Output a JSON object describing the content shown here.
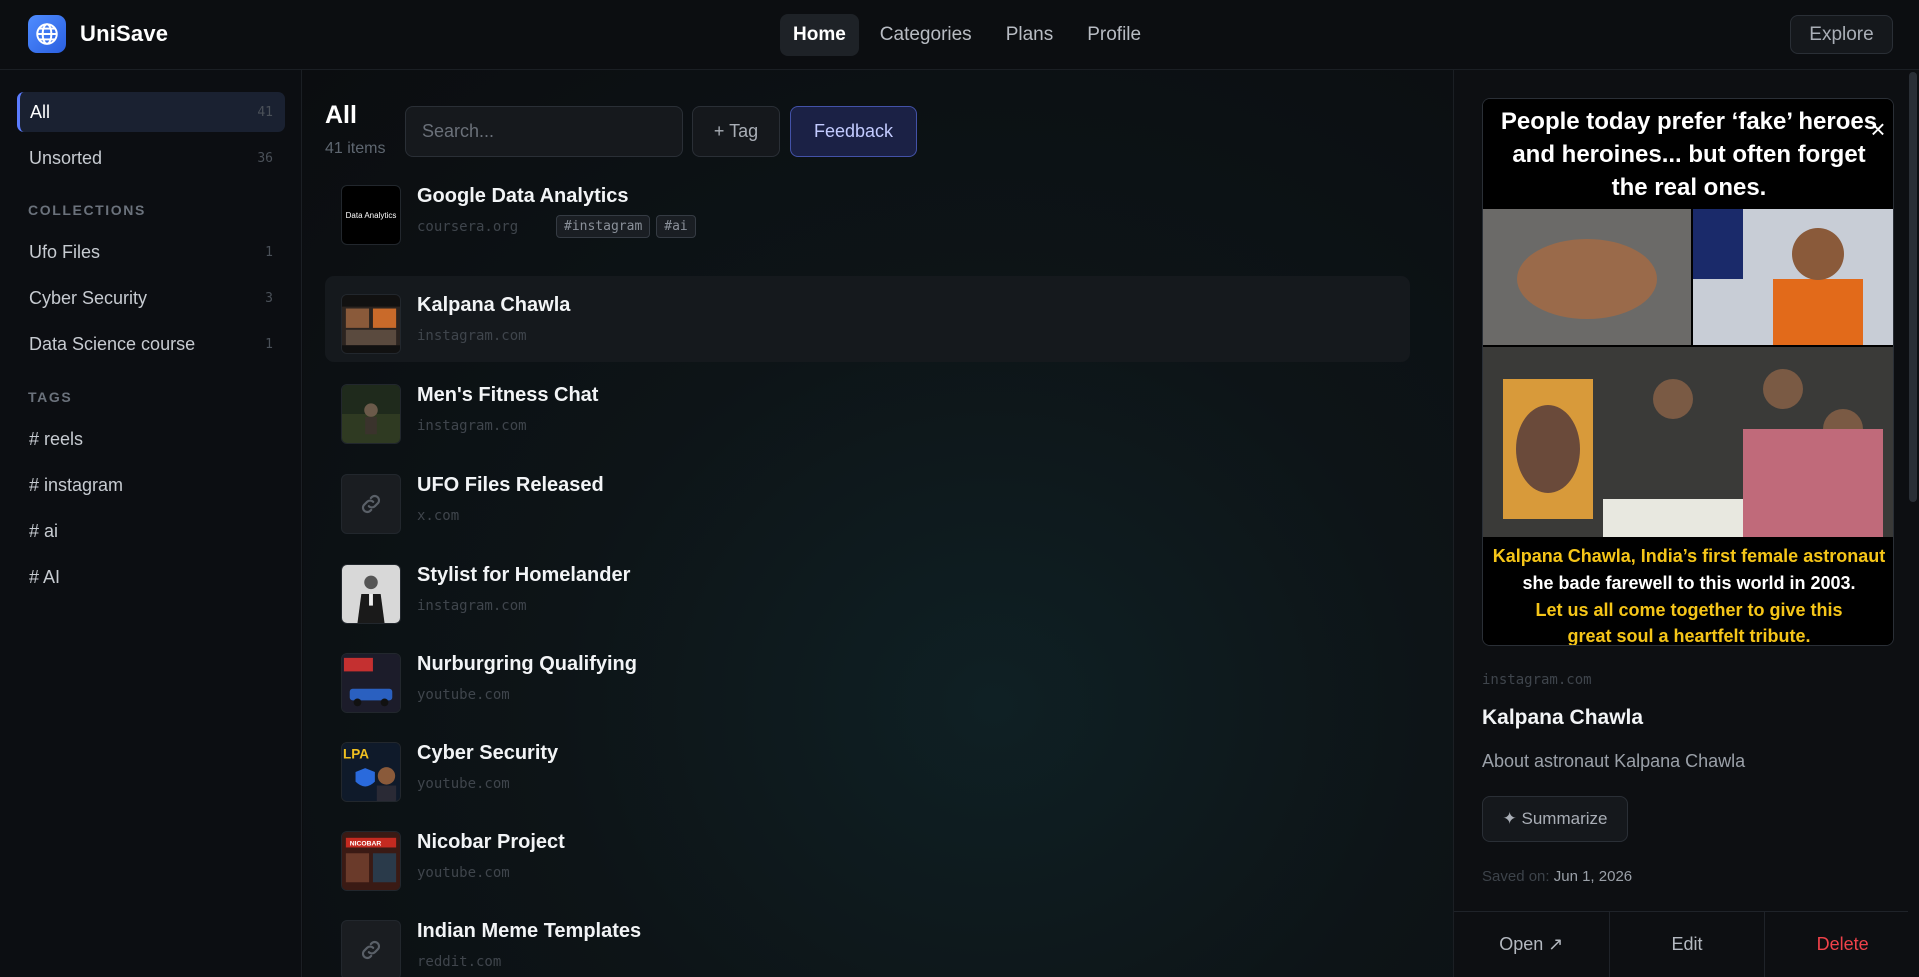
{
  "app": {
    "name": "UniSave"
  },
  "nav": {
    "items": [
      {
        "label": "Home",
        "active": true
      },
      {
        "label": "Categories"
      },
      {
        "label": "Plans"
      },
      {
        "label": "Profile"
      }
    ],
    "explore_label": "Explore"
  },
  "sidebar": {
    "all": {
      "label": "All",
      "count": "41"
    },
    "unsorted": {
      "label": "Unsorted",
      "count": "36"
    },
    "collections_heading": "COLLECTIONS",
    "collections": [
      {
        "label": "Ufo Files",
        "count": "1"
      },
      {
        "label": "Cyber Security",
        "count": "3"
      },
      {
        "label": "Data Science course",
        "count": "1"
      }
    ],
    "tags_heading": "TAGS",
    "tags": [
      {
        "label": "# reels"
      },
      {
        "label": "# instagram"
      },
      {
        "label": "# ai"
      },
      {
        "label": "# AI"
      }
    ]
  },
  "main": {
    "title": "All",
    "subtitle": "41 items",
    "search_placeholder": "Search...",
    "tag_button": "+ Tag",
    "feedback_button": "Feedback",
    "items": [
      {
        "title": "Google Data Analytics",
        "domain": "coursera.org",
        "tags": [
          "#instagram",
          "#ai"
        ],
        "thumb": "google"
      },
      {
        "title": "Kalpana Chawla",
        "domain": "instagram.com",
        "selected": true,
        "thumb": "kalpana"
      },
      {
        "title": "Men's Fitness Chat",
        "domain": "instagram.com",
        "thumb": "fitness"
      },
      {
        "title": "UFO Files Released",
        "domain": "x.com",
        "thumb": "link"
      },
      {
        "title": "Stylist for Homelander",
        "domain": "instagram.com",
        "thumb": "stylist"
      },
      {
        "title": "Nurburgring Qualifying",
        "domain": "youtube.com",
        "thumb": "racing"
      },
      {
        "title": "Cyber Security",
        "domain": "youtube.com",
        "thumb": "cyber"
      },
      {
        "title": "Nicobar Project",
        "domain": "youtube.com",
        "thumb": "nicobar"
      },
      {
        "title": "Indian Meme Templates",
        "domain": "reddit.com",
        "thumb": "link"
      }
    ]
  },
  "panel": {
    "preview_text": {
      "line1": "People today prefer ‘fake’ heroes",
      "line2": "and heroines... but often forget",
      "line3": "the real ones.",
      "bottom1": "Kalpana Chawla, India’s first female astronaut",
      "bottom2": "she bade farewell to this world in 2003.",
      "bottom3": "Let us all come together to give this",
      "bottom4": "great soul a heartfelt tribute."
    },
    "close": "×",
    "domain": "instagram.com",
    "title": "Kalpana Chawla",
    "description": "About astronaut Kalpana Chawla",
    "summarize": "✦ Summarize",
    "saved_label": "Saved on:",
    "saved_value": "Jun 1, 2026",
    "actions": {
      "open": "Open ↗",
      "edit": "Edit",
      "delete": "Delete"
    }
  },
  "thumb_texts": {
    "google": "Data Analytics",
    "cyber": "LPA",
    "nicobar": "NICOBAR"
  }
}
